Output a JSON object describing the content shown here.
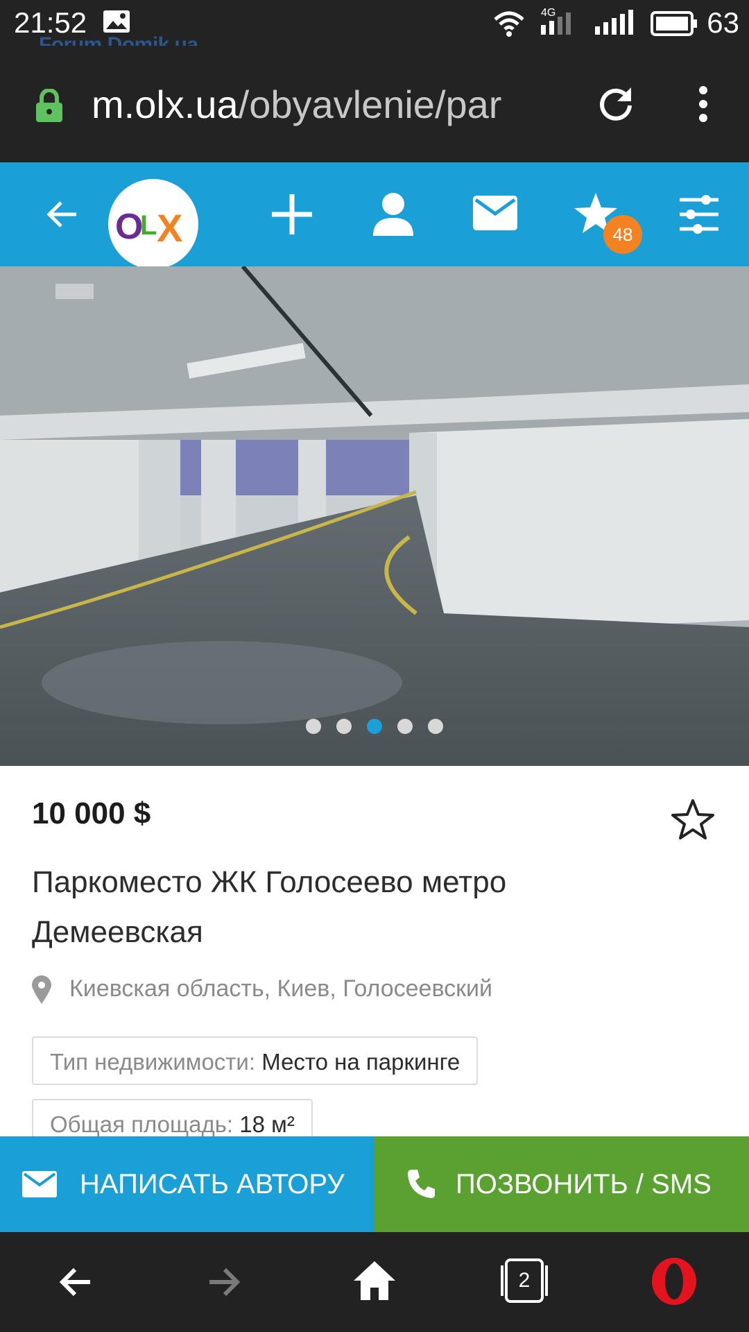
{
  "status_bar": {
    "time": "21:52",
    "battery": "63",
    "network": "4G",
    "icons": [
      "image-icon",
      "wifi-icon",
      "signal-icon",
      "battery-icon"
    ]
  },
  "watermark": "Forum.Domik.ua",
  "browser": {
    "url_host": "m.olx.ua",
    "url_path": "/obyavlenie/par"
  },
  "olx_header": {
    "logo_letters": [
      "O",
      "L",
      "X"
    ],
    "favorites_count": "48",
    "colors": {
      "bar": "#1a9fd6",
      "badge": "#f58220"
    }
  },
  "gallery": {
    "total_images": 5,
    "active_index": 2
  },
  "listing": {
    "price": "10 000 $",
    "title": "Паркоместо ЖК Голосеево метро Демеевская",
    "location": "Киевская область, Киев, Голосеевский",
    "params": [
      {
        "key": "Тип недвижимости:",
        "value": "Место на паркинге"
      },
      {
        "key": "Общая площадь:",
        "value": "18 м²"
      }
    ]
  },
  "actions": {
    "write": "НАПИСАТЬ АВТОРУ",
    "call": "ПОЗВОНИТЬ / SMS",
    "colors": {
      "write": "#1a9fd6",
      "call": "#5aa131"
    }
  },
  "nav": {
    "tabs_count": "2"
  }
}
